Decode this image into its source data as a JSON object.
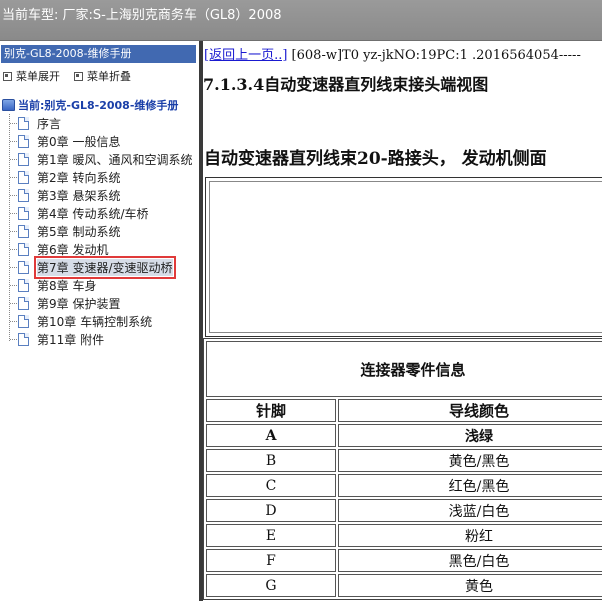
{
  "header": {
    "vehicle_line": "当前车型:  厂家:S-上海别克商务车（GL8）2008"
  },
  "sidebar": {
    "title": "别克-GL8-2008-维修手册",
    "expand_label": "菜单展开",
    "collapse_label": "菜单折叠",
    "root_label": "当前:别克-GL8-2008-维修手册",
    "items": [
      {
        "label": "序言"
      },
      {
        "label": "第0章 一般信息"
      },
      {
        "label": "第1章 暖风、通风和空调系统"
      },
      {
        "label": "第2章 转向系统"
      },
      {
        "label": "第3章 悬架系统"
      },
      {
        "label": "第4章 传动系统/车桥"
      },
      {
        "label": "第5章 制动系统"
      },
      {
        "label": "第6章 发动机"
      },
      {
        "label": "第7章 变速器/变速驱动桥",
        "selected": true
      },
      {
        "label": "第8章 车身"
      },
      {
        "label": "第9章 保护装置"
      },
      {
        "label": "第10章 车辆控制系统"
      },
      {
        "label": "第11章 附件"
      }
    ]
  },
  "content": {
    "back_link": "[返回上一页..]",
    "doc_ref": " [608-w]T0 yz-jkNO:19PC:1 .2016564054-----",
    "section_title": "7.1.3.4自动变速器直列线束接头端视图",
    "sub_title": "自动变速器直列线束20-路接头， 发动机侧面",
    "table": {
      "caption": "连接器零件信息",
      "col_pin": "针脚",
      "col_color": "导线颜色",
      "rows": [
        {
          "pin": "A",
          "color": "浅绿",
          "bold": true
        },
        {
          "pin": "B",
          "color": "黄色/黑色"
        },
        {
          "pin": "C",
          "color": "红色/黑色"
        },
        {
          "pin": "D",
          "color": "浅蓝/白色"
        },
        {
          "pin": "E",
          "color": "粉红"
        },
        {
          "pin": "F",
          "color": "黑色/白色"
        },
        {
          "pin": "G",
          "color": "黄色"
        }
      ]
    }
  },
  "colors": {
    "topbar": "#8f8f8f",
    "sidebar_title_bg": "#4169b1",
    "link": "#1a1ad0",
    "selection_outline": "#e03a3a"
  }
}
